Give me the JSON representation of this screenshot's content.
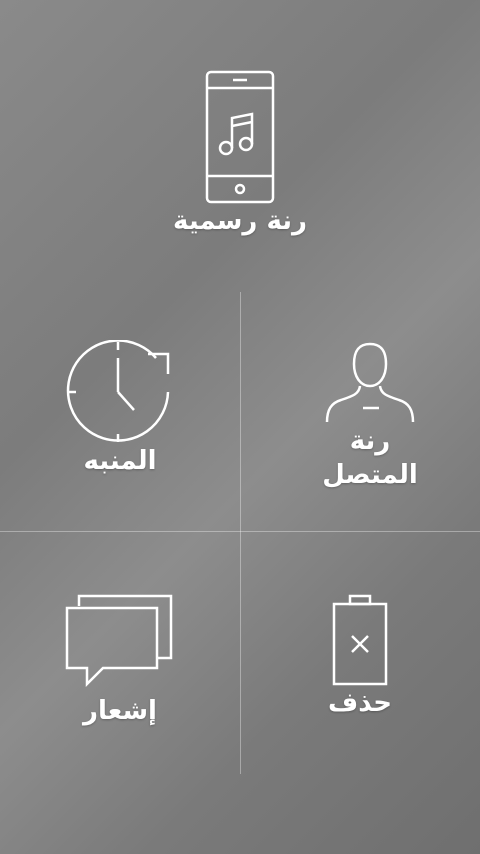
{
  "tiles": {
    "ringtone": {
      "label": "رنة رسمية",
      "icon": "phone-music-icon"
    },
    "alarm": {
      "label": "المنبه",
      "icon": "clock-refresh-icon"
    },
    "contact": {
      "label_line1": "رنة",
      "label_line2": "المتصل",
      "icon": "person-icon"
    },
    "notification": {
      "label": "إشعار",
      "icon": "chat-bubbles-icon"
    },
    "delete": {
      "label": "حذف",
      "icon": "battery-x-icon"
    }
  },
  "colors": {
    "background": "#808080",
    "foreground": "#ffffff"
  }
}
